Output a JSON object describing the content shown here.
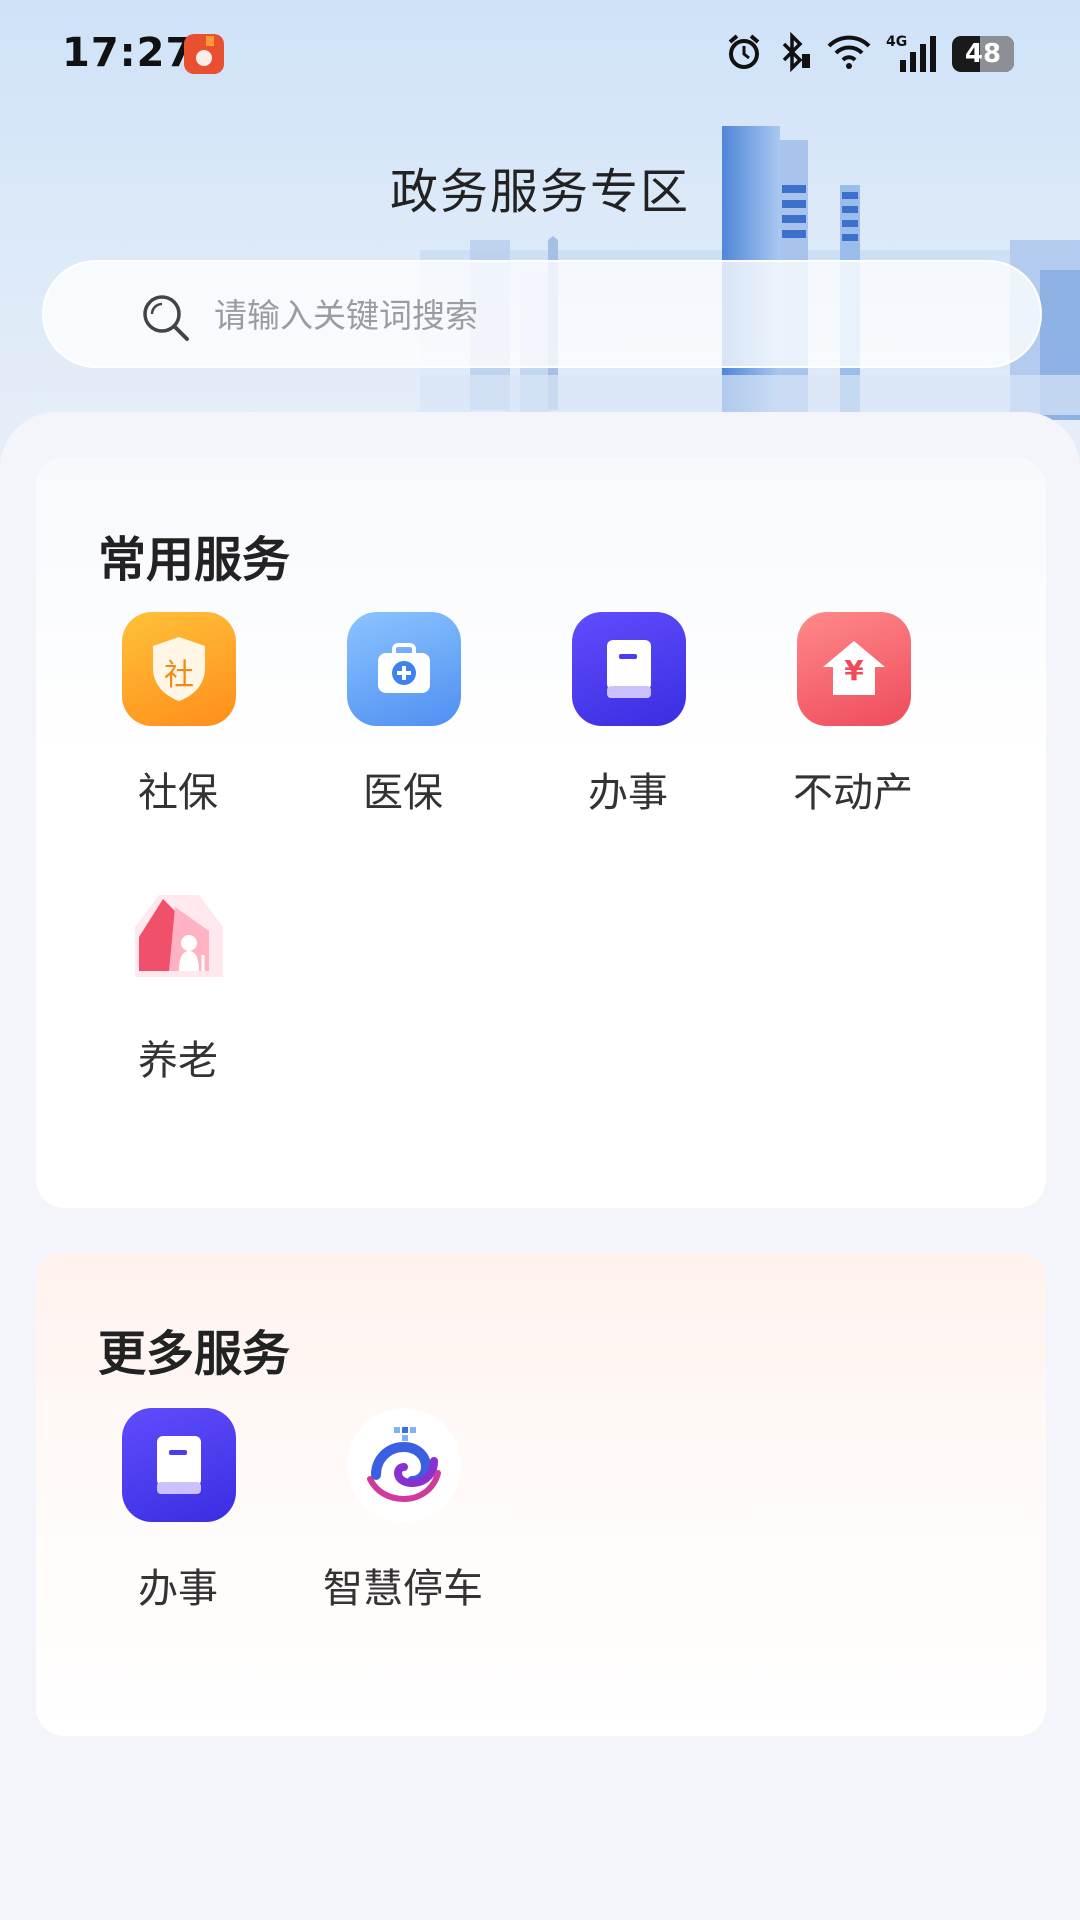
{
  "status_bar": {
    "time": "17:27",
    "battery_level": "48",
    "icons": [
      "app-notification-icon",
      "alarm-icon",
      "bluetooth-icon",
      "wifi-icon",
      "signal-4g-icon",
      "battery-icon"
    ],
    "network_label": "4G"
  },
  "header": {
    "title": "政务服务专区"
  },
  "search": {
    "placeholder": "请输入关键词搜索",
    "icon": "search-icon"
  },
  "common_services": {
    "title": "常用服务",
    "items": [
      {
        "label": "社保",
        "icon": "social-security-shield-icon",
        "glyph": "社",
        "color": "#ffa21f"
      },
      {
        "label": "医保",
        "icon": "medical-kit-icon",
        "color": "#5aa0f8"
      },
      {
        "label": "办事",
        "icon": "book-icon",
        "color": "#4a3cf0"
      },
      {
        "label": "不动产",
        "icon": "property-house-icon",
        "glyph": "¥",
        "color": "#f25766"
      },
      {
        "label": "养老",
        "icon": "elderly-care-icon",
        "color": "#f0506a"
      }
    ]
  },
  "more_services": {
    "title": "更多服务",
    "items": [
      {
        "label": "办事",
        "icon": "book-icon",
        "color": "#4a3cf0"
      },
      {
        "label": "智慧停车",
        "icon": "smart-parking-logo-icon",
        "color": "#3a5fe0"
      }
    ]
  }
}
